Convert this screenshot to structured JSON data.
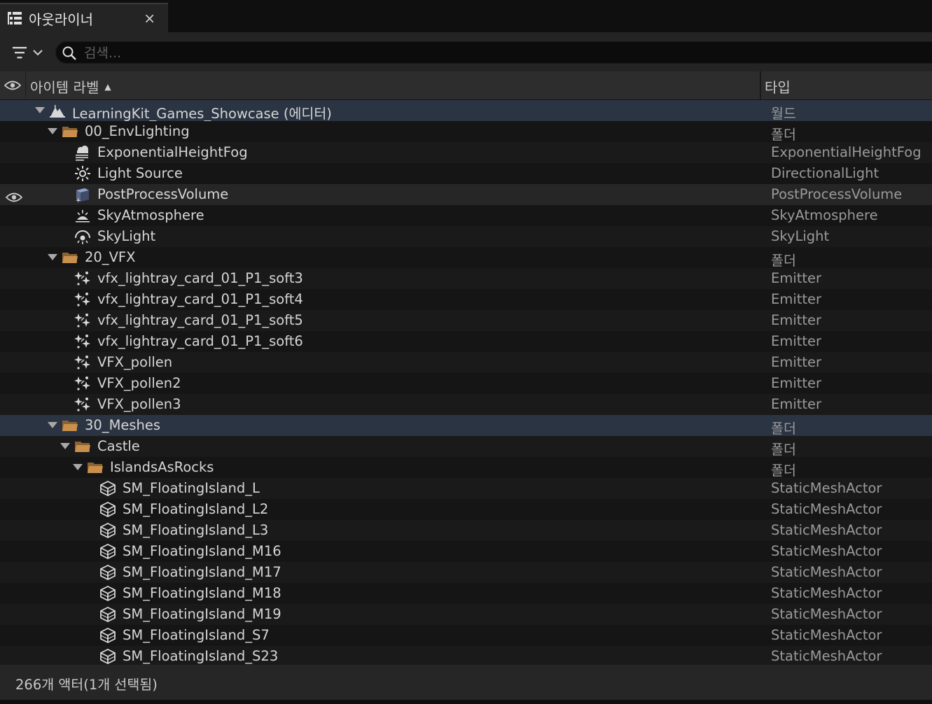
{
  "tab": {
    "title": "아웃라이너",
    "close": "×"
  },
  "search": {
    "placeholder": "검색..."
  },
  "header": {
    "label_col": "아이템 라벨",
    "sort": "▲",
    "type_col": "타입"
  },
  "rows": [
    {
      "label": "LearningKit_Games_Showcase (에디터)",
      "type": "월드",
      "depth": 0,
      "expander": true,
      "icon": "world-icon",
      "state": "sel"
    },
    {
      "label": "00_EnvLighting",
      "type": "폴더",
      "depth": 1,
      "expander": true,
      "icon": "folder-icon"
    },
    {
      "label": "ExponentialHeightFog",
      "type": "ExponentialHeightFog",
      "depth": 2,
      "expander": false,
      "icon": "fog-icon"
    },
    {
      "label": "Light Source",
      "type": "DirectionalLight",
      "depth": 2,
      "expander": false,
      "icon": "sun-icon"
    },
    {
      "label": "PostProcessVolume",
      "type": "PostProcessVolume",
      "depth": 2,
      "expander": false,
      "icon": "volume-icon",
      "state": "hl",
      "visible": true
    },
    {
      "label": "SkyAtmosphere",
      "type": "SkyAtmosphere",
      "depth": 2,
      "expander": false,
      "icon": "sky-atmosphere-icon"
    },
    {
      "label": "SkyLight",
      "type": "SkyLight",
      "depth": 2,
      "expander": false,
      "icon": "skylight-icon"
    },
    {
      "label": "20_VFX",
      "type": "폴더",
      "depth": 1,
      "expander": true,
      "icon": "folder-icon"
    },
    {
      "label": "vfx_lightray_card_01_P1_soft3",
      "type": "Emitter",
      "depth": 2,
      "expander": false,
      "icon": "emitter-icon"
    },
    {
      "label": "vfx_lightray_card_01_P1_soft4",
      "type": "Emitter",
      "depth": 2,
      "expander": false,
      "icon": "emitter-icon"
    },
    {
      "label": "vfx_lightray_card_01_P1_soft5",
      "type": "Emitter",
      "depth": 2,
      "expander": false,
      "icon": "emitter-icon"
    },
    {
      "label": "vfx_lightray_card_01_P1_soft6",
      "type": "Emitter",
      "depth": 2,
      "expander": false,
      "icon": "emitter-icon"
    },
    {
      "label": "VFX_pollen",
      "type": "Emitter",
      "depth": 2,
      "expander": false,
      "icon": "emitter-icon"
    },
    {
      "label": "VFX_pollen2",
      "type": "Emitter",
      "depth": 2,
      "expander": false,
      "icon": "emitter-icon"
    },
    {
      "label": "VFX_pollen3",
      "type": "Emitter",
      "depth": 2,
      "expander": false,
      "icon": "emitter-icon"
    },
    {
      "label": "30_Meshes",
      "type": "폴더",
      "depth": 1,
      "expander": true,
      "icon": "folder-icon",
      "state": "sel"
    },
    {
      "label": "Castle",
      "type": "폴더",
      "depth": 2,
      "expander": true,
      "icon": "folder-icon"
    },
    {
      "label": "IslandsAsRocks",
      "type": "폴더",
      "depth": 3,
      "expander": true,
      "icon": "folder-icon"
    },
    {
      "label": "SM_FloatingIsland_L",
      "type": "StaticMeshActor",
      "depth": 4,
      "expander": false,
      "icon": "static-mesh-icon"
    },
    {
      "label": "SM_FloatingIsland_L2",
      "type": "StaticMeshActor",
      "depth": 4,
      "expander": false,
      "icon": "static-mesh-icon"
    },
    {
      "label": "SM_FloatingIsland_L3",
      "type": "StaticMeshActor",
      "depth": 4,
      "expander": false,
      "icon": "static-mesh-icon"
    },
    {
      "label": "SM_FloatingIsland_M16",
      "type": "StaticMeshActor",
      "depth": 4,
      "expander": false,
      "icon": "static-mesh-icon"
    },
    {
      "label": "SM_FloatingIsland_M17",
      "type": "StaticMeshActor",
      "depth": 4,
      "expander": false,
      "icon": "static-mesh-icon"
    },
    {
      "label": "SM_FloatingIsland_M18",
      "type": "StaticMeshActor",
      "depth": 4,
      "expander": false,
      "icon": "static-mesh-icon"
    },
    {
      "label": "SM_FloatingIsland_M19",
      "type": "StaticMeshActor",
      "depth": 4,
      "expander": false,
      "icon": "static-mesh-icon"
    },
    {
      "label": "SM_FloatingIsland_S7",
      "type": "StaticMeshActor",
      "depth": 4,
      "expander": false,
      "icon": "static-mesh-icon"
    },
    {
      "label": "SM_FloatingIsland_S23",
      "type": "StaticMeshActor",
      "depth": 4,
      "expander": false,
      "icon": "static-mesh-icon"
    }
  ],
  "status": {
    "text": "266개 액터(1개 선택됨)"
  },
  "colors": {
    "folder": "#c8904c",
    "selection": "#2b3442",
    "background": "#151515"
  }
}
